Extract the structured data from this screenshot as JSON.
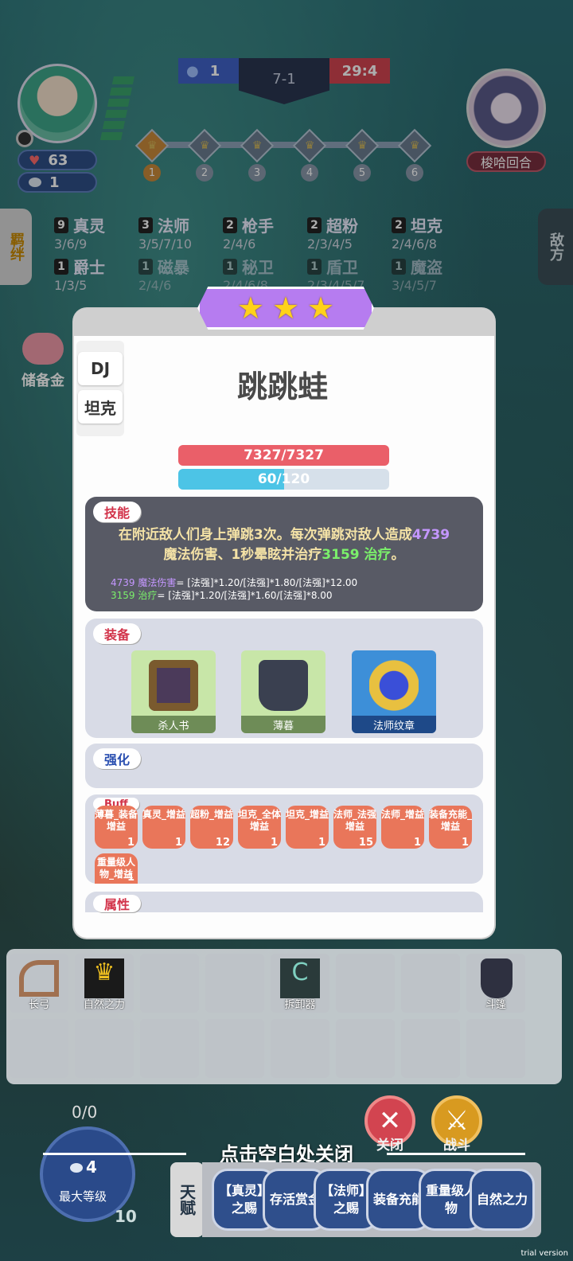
{
  "hud": {
    "health": "63",
    "coins": "1",
    "team_blue_score": "1",
    "stage": "7-1",
    "timer": "29:4",
    "enemy_label": "梭哈回合",
    "rounds": [
      "1",
      "2",
      "3",
      "4",
      "5",
      "6"
    ],
    "left_tab": "羁绊",
    "right_tab": "敌方",
    "piggy_bank_label": "储备金"
  },
  "synergies": [
    {
      "count": "9",
      "name": "真灵",
      "tiers": "3/6/9"
    },
    {
      "count": "3",
      "name": "法师",
      "tiers": "3/5/7/10"
    },
    {
      "count": "2",
      "name": "枪手",
      "tiers": "2/4/6"
    },
    {
      "count": "2",
      "name": "超粉",
      "tiers": "2/3/4/5"
    },
    {
      "count": "2",
      "name": "坦克",
      "tiers": "2/4/6/8"
    },
    {
      "count": "1",
      "name": "爵士",
      "tiers": "1/3/5"
    },
    {
      "count": "1",
      "name": "磁暴",
      "tiers": "2/4/6"
    },
    {
      "count": "1",
      "name": "秘卫",
      "tiers": "2/4/6/8"
    },
    {
      "count": "1",
      "name": "盾卫",
      "tiers": "2/3/4/5/7"
    },
    {
      "count": "1",
      "name": "魔盗",
      "tiers": "3/4/5/7"
    }
  ],
  "unit": {
    "stars": 3,
    "tags": [
      "DJ",
      "坦克"
    ],
    "name": "跳跳蛙",
    "hp_text": "7327/7327",
    "hp_fraction": 1.0,
    "mana_text": "60/120",
    "mana_fraction": 0.5
  },
  "skill": {
    "title": "技能",
    "desc_1": "在附近敌人们身上弹跳3次。每次弹跳对敌人造成",
    "desc_dmg": "4739",
    "desc_2": "魔法伤害、1秒晕眩并治疗",
    "desc_heal": "3159 治疗",
    "desc_3": "。",
    "formula_1_value": "4739 魔法伤害",
    "formula_1_rest": "= [法强]*1.20/[法强]*1.80/[法强]*12.00",
    "formula_2_value": "3159 治疗",
    "formula_2_rest": "= [法强]*1.20/[法强]*1.60/[法强]*8.00"
  },
  "equipment": {
    "title": "装备",
    "items": [
      "杀人书",
      "薄暮",
      "法师纹章"
    ]
  },
  "enhance": {
    "title": "强化"
  },
  "buffs": {
    "title": "Buff",
    "items": [
      {
        "label": "薄暮_装备增益",
        "count": "1"
      },
      {
        "label": "真灵_增益",
        "count": "1"
      },
      {
        "label": "超粉_增益",
        "count": "12"
      },
      {
        "label": "坦克_全体增益",
        "count": "1"
      },
      {
        "label": "坦克_增益",
        "count": "1"
      },
      {
        "label": "法师_法强增益",
        "count": "15"
      },
      {
        "label": "法师_增益",
        "count": "1"
      },
      {
        "label": "装备充能_增益",
        "count": "1"
      },
      {
        "label": "重量级人物_增益",
        "count": "1"
      }
    ]
  },
  "attributes": {
    "title": "属性"
  },
  "inventory": [
    "长弓",
    "自然之力",
    "",
    "",
    "拆卸器",
    "",
    "",
    "斗篷"
  ],
  "level": {
    "progress": "0/0",
    "coin_cost": "4",
    "label": "最大等级",
    "number": "10"
  },
  "buttons": {
    "close": "关闭",
    "fight": "战斗"
  },
  "close_hint": "点击空白处关闭",
  "talents": {
    "tab": "天赋",
    "items": [
      "【真灵】之赐",
      "存活赏金",
      "【法师】之赐",
      "装备充能",
      "重量级人物",
      "自然之力"
    ]
  },
  "watermark": "trial version",
  "colors": {
    "hp": "#ea5f69",
    "mana": "#4cc4e6",
    "stars": "#ffd21a",
    "banner": "#b67cf0"
  }
}
